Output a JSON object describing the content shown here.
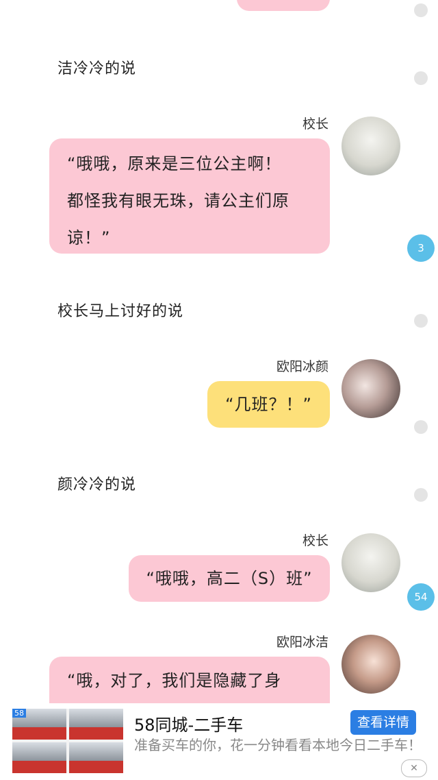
{
  "messages": [
    {
      "narration": "洁冷冷的说"
    },
    {
      "speaker": "校长",
      "text_lines": [
        "“哦哦，原来是三位公主啊！",
        "都怪我有眼无珠，请公主们原",
        "谅！”"
      ],
      "comment_count": "3"
    },
    {
      "narration": "校长马上讨好的说"
    },
    {
      "speaker": "欧阳冰颜",
      "text": "“几班？！”"
    },
    {
      "narration": "颜冷冷的说"
    },
    {
      "speaker": "校长",
      "text": "“哦哦，高二（S）班”",
      "comment_count": "54"
    },
    {
      "speaker": "欧阳冰洁",
      "text": "“哦，对了，我们是隐藏了身"
    }
  ],
  "ad": {
    "title": "58同城-二手车",
    "description": "准备买车的你，花一分钟看看本地今日二手车！",
    "button": "查看详情",
    "image_badge": "58",
    "close_icon": "close-icon"
  },
  "colors": {
    "pink_bubble": "#fcc8d4",
    "yellow_bubble": "#fde07a",
    "count_badge": "#5bbfe8",
    "ad_button": "#2b7ee3"
  }
}
